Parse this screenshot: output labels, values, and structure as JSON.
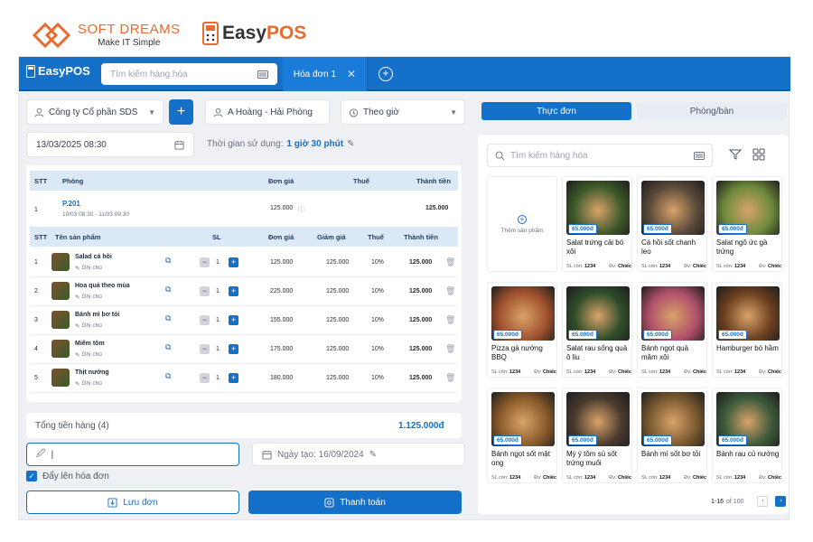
{
  "branding": {
    "softdreams_name": "SOFT DREAMS",
    "softdreams_tagline": "Make IT Simple",
    "easypos_name_a": "Easy",
    "easypos_name_b": "POS"
  },
  "topbar": {
    "brand": "EasyPOS",
    "search_placeholder": "Tìm kiếm hàng hóa",
    "tab_label": "Hóa đơn 1"
  },
  "order": {
    "customer": "Công ty Cổ phần SDS",
    "staff": "A Hoàng - Hải Phòng",
    "mode": "Theo giờ",
    "datetime": "13/03/2025 08:30",
    "usage_label": "Thời gian sử dụng:",
    "usage_value": "1 giờ 30 phút",
    "room_table": {
      "headers": [
        "STT",
        "Phòng",
        "Đơn giá",
        "Thuế",
        "Thành tiền"
      ],
      "row": {
        "stt": "1",
        "room": "P.201",
        "time": "10/03 08:30 - 11/03 09:30",
        "unit_price": "125.000",
        "total": "125.000"
      }
    },
    "product_headers": [
      "STT",
      "Tên sản phẩm",
      "SL",
      "Đơn giá",
      "Giảm giá",
      "Thuế",
      "Thành tiền"
    ],
    "note_label": "Ghi chú",
    "products": [
      {
        "stt": "1",
        "name": "Salad cá hồi",
        "qty": "1",
        "price": "125.000",
        "discount": "125.000",
        "tax": "10%",
        "total": "125.000"
      },
      {
        "stt": "2",
        "name": "Hoa quả theo mùa",
        "qty": "1",
        "price": "225.000",
        "discount": "125.000",
        "tax": "10%",
        "total": "125.000"
      },
      {
        "stt": "3",
        "name": "Bánh mì bơ tỏi",
        "qty": "1",
        "price": "155.000",
        "discount": "125.000",
        "tax": "10%",
        "total": "125.000"
      },
      {
        "stt": "4",
        "name": "Miếm tôm",
        "qty": "1",
        "price": "175.000",
        "discount": "125.000",
        "tax": "10%",
        "total": "125.000"
      },
      {
        "stt": "5",
        "name": "Thịt nướng",
        "qty": "1",
        "price": "180.000",
        "discount": "125.000",
        "tax": "10%",
        "total": "125.000"
      }
    ],
    "total_label": "Tổng tiền hàng (4)",
    "total_value": "1.125.000đ",
    "note_input_value": "|",
    "created_label": "Ngày tạo: 16/09/2024",
    "push_invoice_label": "Đẩy lên hóa đơn",
    "save_label": "Lưu đơn",
    "pay_label": "Thanh toán"
  },
  "menu": {
    "tab_menu": "Thực đơn",
    "tab_room": "Phòng/bàn",
    "search_placeholder": "Tìm kiếm hàng hóa",
    "add_product": "Thêm sản phẩm",
    "stock_label": "SL còn:",
    "unit_label": "Đv:",
    "items": [
      {
        "name": "Salat trứng cải bó xôi",
        "price": "65.000đ",
        "stock": "1234",
        "unit": "Chiếc",
        "color": "#3f5a2a"
      },
      {
        "name": "Cá hồi sốt chanh leo",
        "price": "65.000đ",
        "stock": "1234",
        "unit": "Chiếc",
        "color": "#5b4a3a"
      },
      {
        "name": "Salat ngô ức gà trứng",
        "price": "65.000đ",
        "stock": "1234",
        "unit": "Chiếc",
        "color": "#6e8a3c"
      },
      {
        "name": "Pizza gà nướng BBQ",
        "price": "65.000đ",
        "stock": "1234",
        "unit": "Chiếc",
        "color": "#a0522d"
      },
      {
        "name": "Salat rau sống quả ô liu",
        "price": "65.000đ",
        "stock": "1234",
        "unit": "Chiếc",
        "color": "#2f4d2a"
      },
      {
        "name": "Bánh ngọt quả mâm xôi",
        "price": "65.000đ",
        "stock": "1234",
        "unit": "Chiếc",
        "color": "#b0506a"
      },
      {
        "name": "Hamburger bò hầm",
        "price": "65.000đ",
        "stock": "1234",
        "unit": "Chiếc",
        "color": "#6b3f1f"
      },
      {
        "name": "Bánh ngọt sốt mật ong",
        "price": "65.000đ",
        "stock": "1234",
        "unit": "Chiếc",
        "color": "#8a5a2a"
      },
      {
        "name": "Mỳ ý tôm sú sốt trứng muối",
        "price": "65.000đ",
        "stock": "1234",
        "unit": "Chiếc",
        "color": "#4a3a2e"
      },
      {
        "name": "Bánh mì sốt bơ tỏi",
        "price": "65.000đ",
        "stock": "1234",
        "unit": "Chiếc",
        "color": "#7a5a30"
      },
      {
        "name": "Bánh rau củ nướng",
        "price": "65.000đ",
        "stock": "1234",
        "unit": "Chiếc",
        "color": "#3c5a3a"
      }
    ],
    "pagination": "1-16",
    "pagination_of": "of 100"
  },
  "colors": {
    "primary": "#1570c9",
    "brand_orange": "#ea6b2d"
  }
}
